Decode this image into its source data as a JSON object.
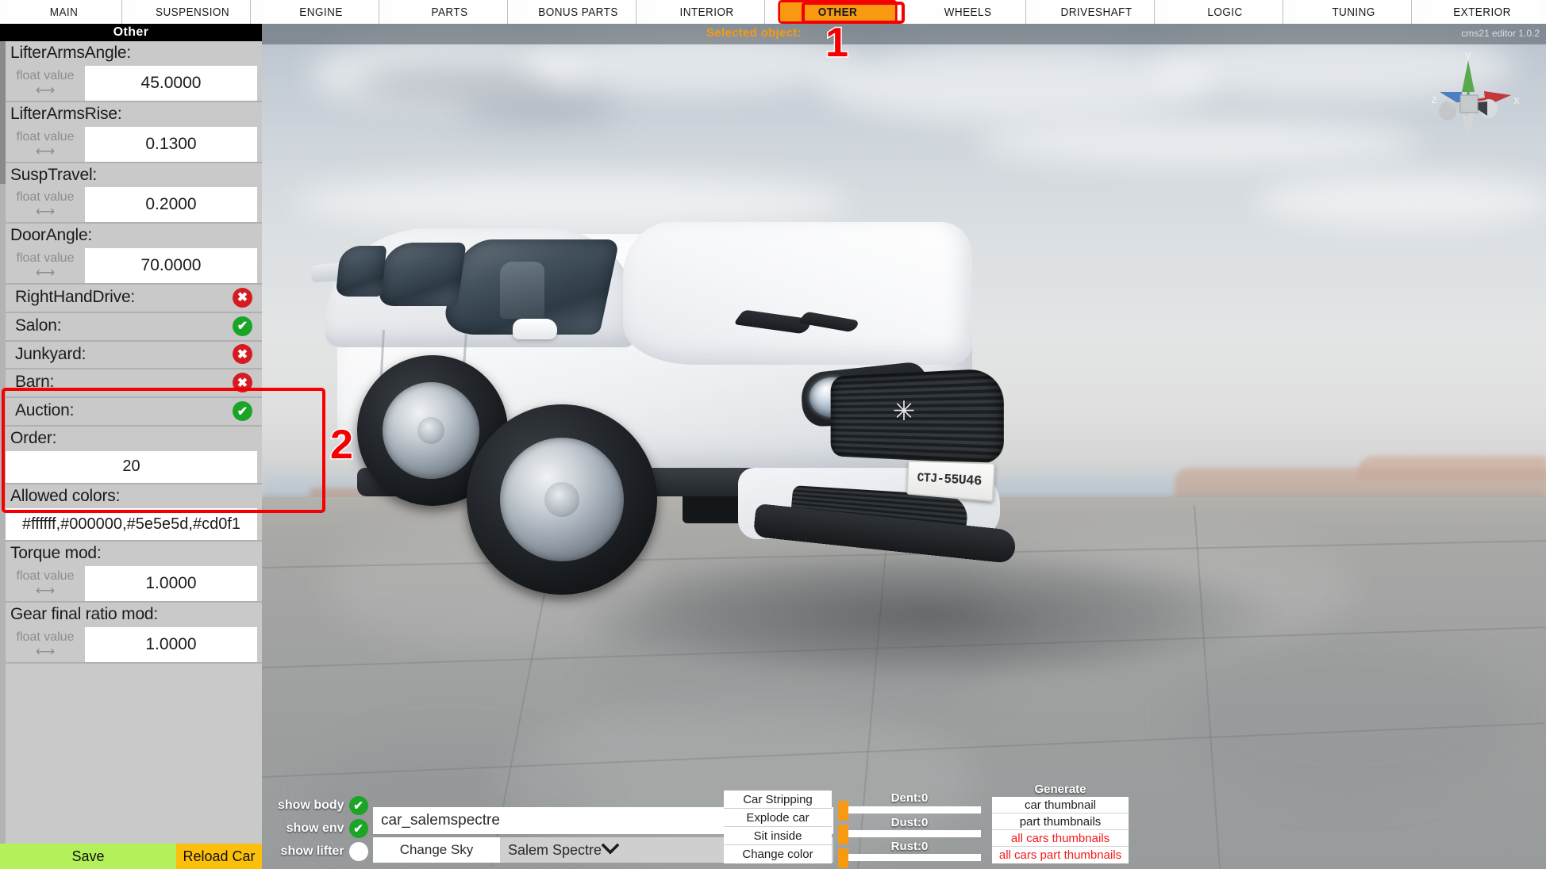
{
  "app": {
    "version_label": "cms21 editor 1.0.2",
    "selected_object_label": "Selected object:"
  },
  "tabs": [
    {
      "label": "MAIN",
      "active": false
    },
    {
      "label": "SUSPENSION",
      "active": false
    },
    {
      "label": "ENGINE",
      "active": false
    },
    {
      "label": "PARTS",
      "active": false
    },
    {
      "label": "BONUS PARTS",
      "active": false
    },
    {
      "label": "INTERIOR",
      "active": false
    },
    {
      "label": "OTHER",
      "active": true
    },
    {
      "label": "WHEELS",
      "active": false
    },
    {
      "label": "DRIVESHAFT",
      "active": false
    },
    {
      "label": "LOGIC",
      "active": false
    },
    {
      "label": "TUNING",
      "active": false
    },
    {
      "label": "EXTERIOR",
      "active": false
    }
  ],
  "panel": {
    "title": "Other",
    "float_hint": "float value",
    "arrows_icon": "⟷",
    "fields": [
      {
        "label": "LifterArmsAngle:",
        "type": "float",
        "value": "45.0000"
      },
      {
        "label": "LifterArmsRise:",
        "type": "float",
        "value": "0.1300"
      },
      {
        "label": "SuspTravel:",
        "type": "float",
        "value": "0.2000"
      },
      {
        "label": "DoorAngle:",
        "type": "float",
        "value": "70.0000"
      },
      {
        "label": "RightHandDrive:",
        "type": "bool",
        "value": false
      },
      {
        "label": "Salon:",
        "type": "bool",
        "value": true
      },
      {
        "label": "Junkyard:",
        "type": "bool",
        "value": false
      },
      {
        "label": "Barn:",
        "type": "bool",
        "value": false
      },
      {
        "label": "Auction:",
        "type": "bool",
        "value": true
      },
      {
        "label": "Order:",
        "type": "text",
        "value": "20"
      },
      {
        "label": "Allowed colors:",
        "type": "text",
        "value": "#ffffff,#000000,#5e5e5d,#cd0f1"
      },
      {
        "label": "Torque mod:",
        "type": "float",
        "value": "1.0000"
      },
      {
        "label": "Gear final ratio mod:",
        "type": "float",
        "value": "1.0000"
      }
    ],
    "save_label": "Save",
    "reload_label": "Reload Car"
  },
  "bottom": {
    "toggles": [
      {
        "label": "show body",
        "state": "on"
      },
      {
        "label": "show env",
        "state": "on"
      },
      {
        "label": "show lifter",
        "state": "blank"
      }
    ],
    "car_dropdown_value": "car_salemspectre",
    "change_sky_label": "Change Sky",
    "sky_dropdown_value": "Salem Spectre",
    "caret_icon": "⌄",
    "actions": [
      {
        "label": "Car Stripping"
      },
      {
        "label": "Explode car"
      },
      {
        "label": "Sit inside"
      },
      {
        "label": "Change color"
      }
    ],
    "sliders": [
      {
        "label": "Dent:0",
        "value": 0
      },
      {
        "label": "Dust:0",
        "value": 0
      },
      {
        "label": "Rust:0",
        "value": 0
      }
    ],
    "generate_title": "Generate",
    "generate_buttons": [
      {
        "label": "car thumbnail",
        "red": false
      },
      {
        "label": "part thumbnails",
        "red": false
      },
      {
        "label": "all cars thumbnails",
        "red": true
      },
      {
        "label": "all cars part thumbnails",
        "red": true
      }
    ]
  },
  "viewport": {
    "license_plate": "CTJ-55U46",
    "emblem_icon": "✳",
    "gizmo": {
      "axis_x_label": "x",
      "axis_y_label": "y",
      "axis_z_label": "z",
      "color_x": "#c6373c",
      "color_y": "#5aa84f",
      "color_z": "#4a7fc1"
    }
  },
  "annotations": [
    {
      "number": "1"
    },
    {
      "number": "2"
    }
  ],
  "colors": {
    "accent_orange": "#f79a12",
    "annotation_red": "#f50000",
    "check_green": "#1aa526",
    "cross_red": "#d51b20",
    "save_green": "#b3f05a",
    "reload_amber": "#fcc00c",
    "panel_grey": "#c9c9c9"
  }
}
